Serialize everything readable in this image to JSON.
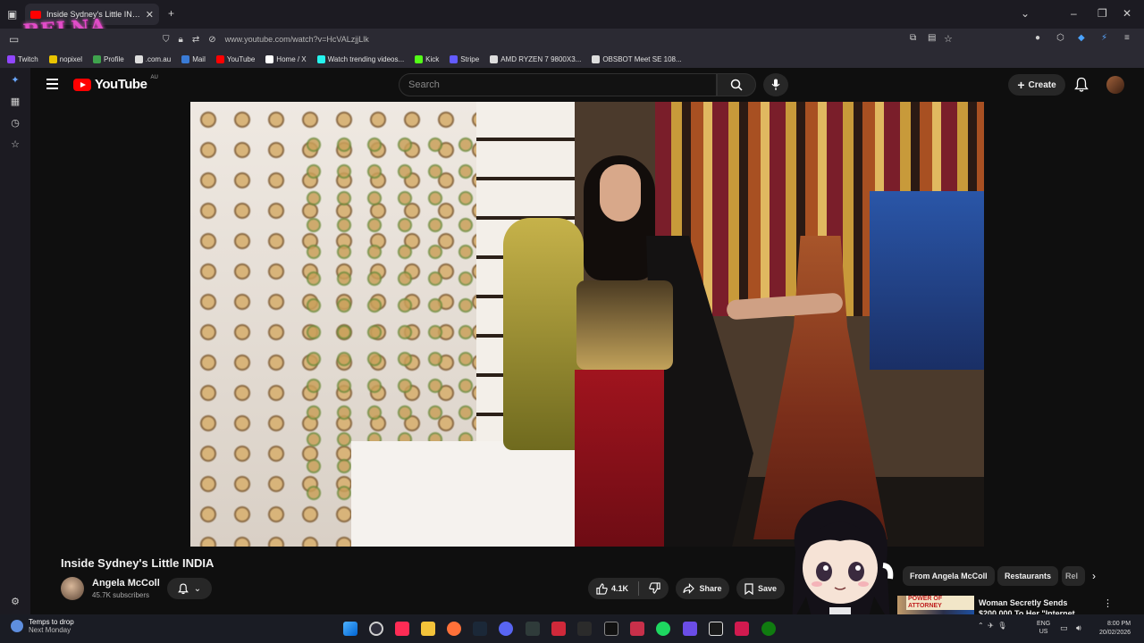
{
  "browser": {
    "tab_title": "Inside Sydney's Little INDIA - Yo",
    "url": "www.youtube.com/watch?v=HcVALzjjLlk",
    "profile_badge": "BELNA",
    "bookmarks": [
      {
        "label": "Twitch",
        "color": "#9146ff"
      },
      {
        "label": "nopixel",
        "color": "#e9c400"
      },
      {
        "label": "Profile",
        "color": "#3fa34d"
      },
      {
        "label": ".com.au",
        "color": "#dddddd"
      },
      {
        "label": "Mail",
        "color": "#3a7bd5"
      },
      {
        "label": "YouTube",
        "color": "#ff0000"
      },
      {
        "label": "Home / X",
        "color": "#ffffff"
      },
      {
        "label": "Watch trending videos...",
        "color": "#25f4ee"
      },
      {
        "label": "Kick",
        "color": "#53fc18"
      },
      {
        "label": "Stripe",
        "color": "#635bff"
      },
      {
        "label": "AMD RYZEN 7 9800X3...",
        "color": "#dddddd"
      },
      {
        "label": "OBSBOT Meet SE 108...",
        "color": "#dddddd"
      }
    ]
  },
  "youtube": {
    "logo_text": "YouTube",
    "region": "AU",
    "search_placeholder": "Search",
    "create_label": "Create"
  },
  "video": {
    "title": "Inside Sydney's Little INDIA",
    "channel": "Angela McColl",
    "subscribers": "45.7K subscribers",
    "likes": "4.1K",
    "share_label": "Share",
    "save_label": "Save"
  },
  "chips": [
    "From Angela McColl",
    "Restaurants",
    "Rel"
  ],
  "recommendation": {
    "title": "Woman Secretly Sends $200,000 To Her \"Internet",
    "thumb_text": "POWER OF ATTORNEY"
  },
  "taskbar": {
    "weather_line1": "Temps to drop",
    "weather_line2": "Next Monday",
    "lang_line1": "ENG",
    "lang_line2": "US",
    "time": "8:00 PM",
    "date": "20/02/2026"
  }
}
